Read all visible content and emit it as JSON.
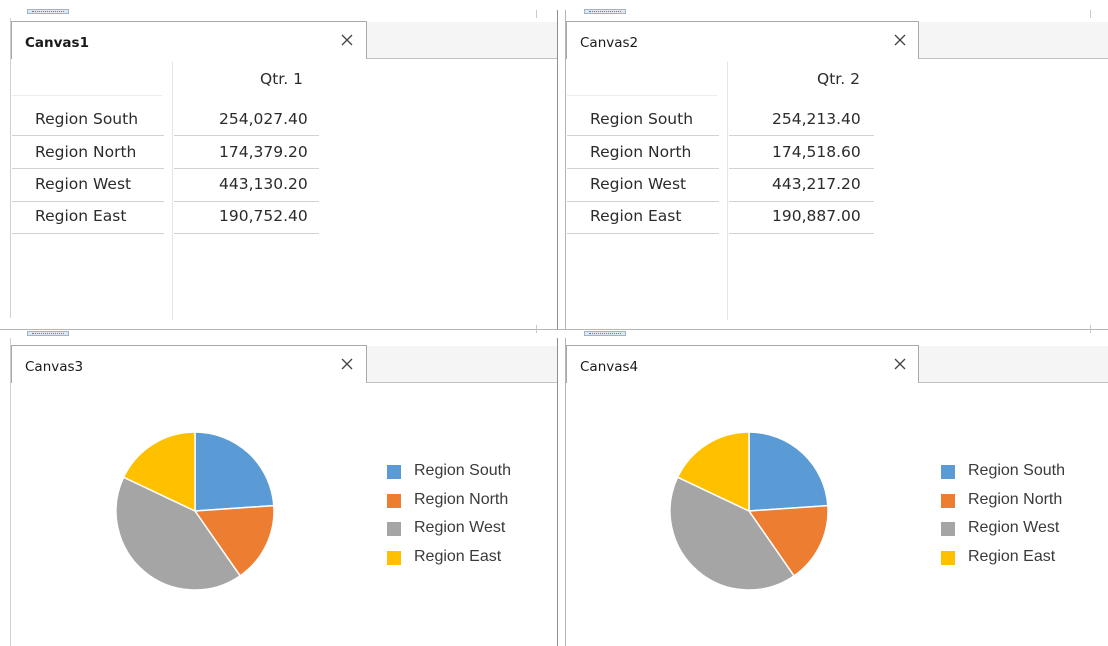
{
  "canvases": [
    {
      "title": "Canvas1",
      "active": true,
      "table": {
        "column_header": "Qtr. 1",
        "rows": [
          {
            "label": "Region South",
            "value": "254,027.40"
          },
          {
            "label": "Region North",
            "value": "174,379.20"
          },
          {
            "label": "Region West",
            "value": "443,130.20"
          },
          {
            "label": "Region East",
            "value": "190,752.40"
          }
        ]
      }
    },
    {
      "title": "Canvas2",
      "active": false,
      "table": {
        "column_header": "Qtr. 2",
        "rows": [
          {
            "label": "Region South",
            "value": "254,213.40"
          },
          {
            "label": "Region North",
            "value": "174,518.60"
          },
          {
            "label": "Region West",
            "value": "443,217.20"
          },
          {
            "label": "Region East",
            "value": "190,887.00"
          }
        ]
      }
    },
    {
      "title": "Canvas3",
      "active": false
    },
    {
      "title": "Canvas4",
      "active": false
    }
  ],
  "close_icon": "close-icon",
  "colors": {
    "tab_strip": "#f5f5f5",
    "tab_border": "#a9a9a9",
    "grip": "#9fb3cc"
  },
  "chart_data": [
    {
      "type": "pie",
      "categories": [
        "Region South",
        "Region North",
        "Region West",
        "Region East"
      ],
      "values": [
        254027.4,
        174379.2,
        443130.2,
        190752.4
      ],
      "colors": [
        "#5b9bd5",
        "#ed7d31",
        "#a5a5a5",
        "#ffc000"
      ],
      "legend": "right"
    },
    {
      "type": "pie",
      "categories": [
        "Region South",
        "Region North",
        "Region West",
        "Region East"
      ],
      "values": [
        254213.4,
        174518.6,
        443217.2,
        190887.0
      ],
      "colors": [
        "#5b9bd5",
        "#ed7d31",
        "#a5a5a5",
        "#ffc000"
      ],
      "legend": "right"
    }
  ]
}
